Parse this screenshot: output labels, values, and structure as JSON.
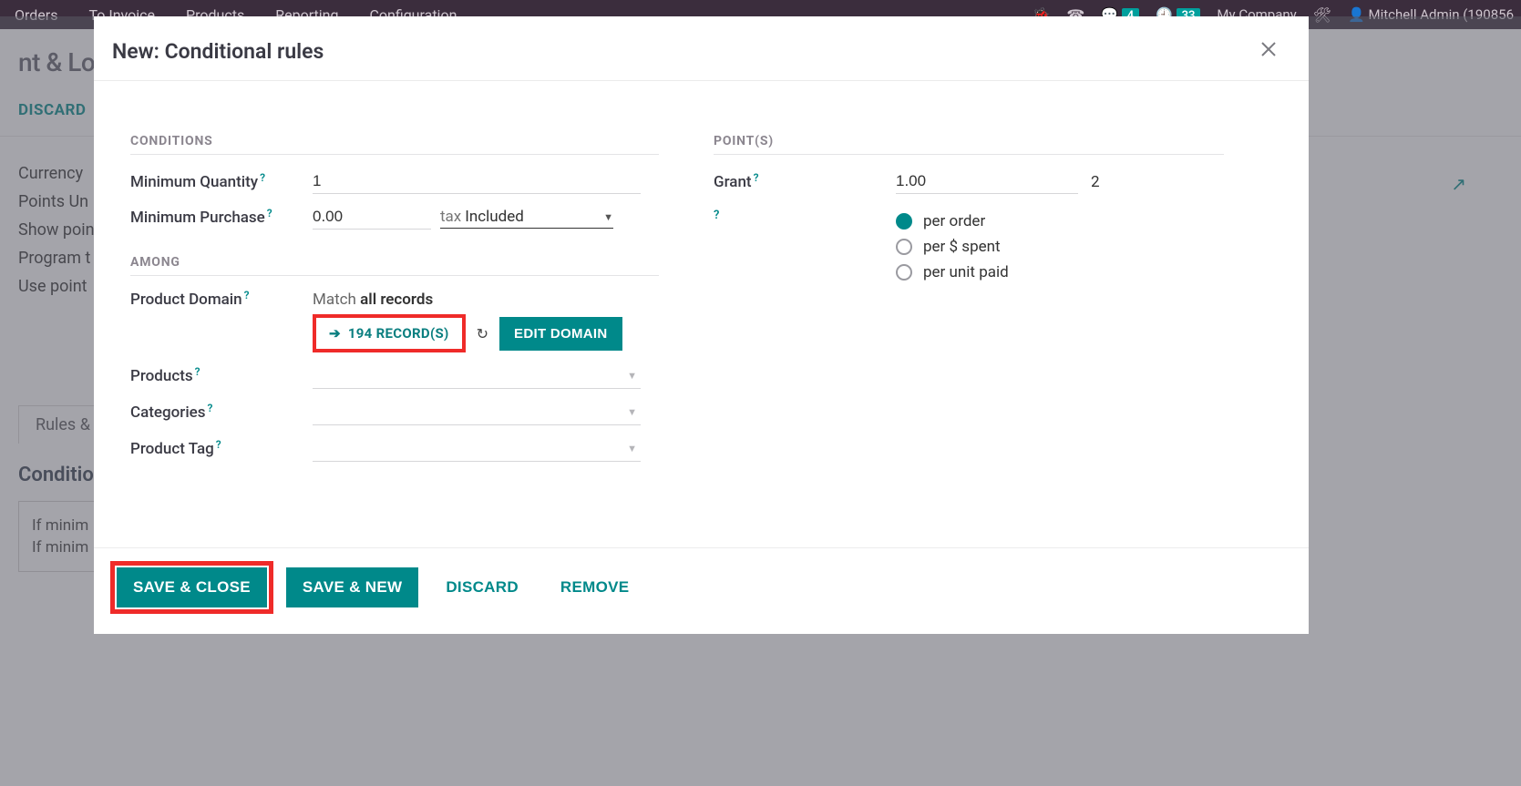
{
  "nav": {
    "items": [
      "Orders",
      "To Invoice",
      "Products",
      "Reporting",
      "Configuration"
    ],
    "badge1": "4",
    "badge2": "33",
    "company": "My Company",
    "user": "Mitchell Admin (190856"
  },
  "under": {
    "title": "nt & Loyal",
    "discard": "DISCARD",
    "fields": [
      "Currency",
      "Points Un",
      "Show poin",
      "Program t",
      "Use point"
    ],
    "tab": "Rules &",
    "section_title": "Conditio",
    "if1": "If minim",
    "if2": "If minim"
  },
  "modal": {
    "title": "New: Conditional rules",
    "conditions": {
      "heading": "CONDITIONS",
      "min_qty_label": "Minimum Quantity",
      "min_qty_value": "1",
      "min_purchase_label": "Minimum Purchase",
      "min_purchase_value": "0.00",
      "tax_label": "tax",
      "tax_value": "Included"
    },
    "among": {
      "heading": "AMONG",
      "product_domain_label": "Product Domain",
      "match_prefix": "Match ",
      "match_bold": "all records",
      "records_label": "194 RECORD(S)",
      "edit_domain": "EDIT DOMAIN",
      "products_label": "Products",
      "categories_label": "Categories",
      "product_tag_label": "Product Tag"
    },
    "points": {
      "heading": "POINT(S)",
      "grant_label": "Grant",
      "grant_value": "1.00",
      "grant_suffix": "2",
      "radios": [
        "per order",
        "per $ spent",
        "per unit paid"
      ],
      "selected": 0
    },
    "footer": {
      "save_close": "SAVE & CLOSE",
      "save_new": "SAVE & NEW",
      "discard": "DISCARD",
      "remove": "REMOVE"
    }
  }
}
